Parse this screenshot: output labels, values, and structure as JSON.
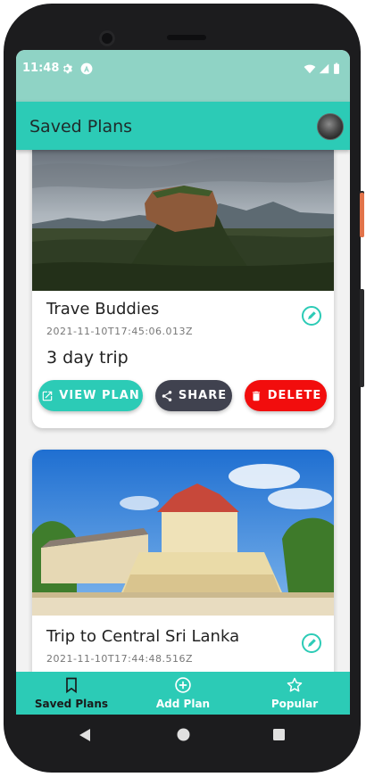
{
  "status_bar": {
    "time": "11:48",
    "left_icons": [
      "gear-icon",
      "a-badge-icon"
    ],
    "right_icons": [
      "wifi-icon",
      "signal-icon",
      "battery-icon"
    ]
  },
  "app_bar": {
    "title": "Saved Plans",
    "avatar": "profile-avatar"
  },
  "plans": [
    {
      "title": "Trave Buddies",
      "date": "2021-11-10T17:45:06.013Z",
      "description": "3 day trip",
      "image": "rock fortress landscape photo",
      "actions": {
        "view_label": "VIEW PLAN",
        "share_label": "SHARE",
        "delete_label": "DELETE"
      }
    },
    {
      "title": "Trip to Central Sri Lanka",
      "date": "2021-11-10T17:44:48.516Z",
      "image": "temple building photo"
    }
  ],
  "bottom_nav": {
    "items": [
      {
        "label": "Saved Plans",
        "icon": "bookmark-icon",
        "active": true
      },
      {
        "label": "Add Plan",
        "icon": "add-circle-icon",
        "active": false
      },
      {
        "label": "Popular",
        "icon": "star-icon",
        "active": false
      }
    ]
  },
  "system_nav": [
    "back-icon",
    "home-icon",
    "recents-icon"
  ],
  "colors": {
    "primary": "#2ccbb6",
    "status_bar": "#8fd3c5",
    "share": "#40424f",
    "delete": "#f20d0d"
  }
}
